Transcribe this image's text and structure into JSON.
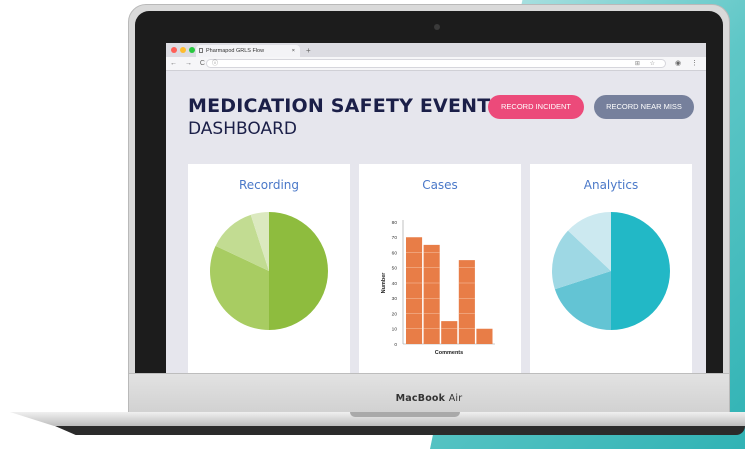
{
  "browser": {
    "tab_title": "Pharmapod GRLS Flow",
    "tab_close": "×",
    "new_tab": "+",
    "nav_buttons": "← → C",
    "url_icon": "ⓘ",
    "omnibox_right": "⊞ ☆",
    "ext_buttons": "◉ ⋮",
    "dot_colors": [
      "#ff5f57",
      "#febc2e",
      "#28c840"
    ]
  },
  "header": {
    "title_bold": "MEDICATION SAFETY EVENT",
    "title_sep": "|",
    "title_light": "DASHBOARD"
  },
  "actions": {
    "record_incident": "RECORD INCIDENT",
    "record_near_miss": "RECORD NEAR MISS"
  },
  "cards": {
    "recording": {
      "title": "Recording"
    },
    "cases": {
      "title": "Cases"
    },
    "analytics": {
      "title": "Analytics"
    }
  },
  "laptop": {
    "brand_bold": "MacBook",
    "brand_light": "Air"
  },
  "chart_data": [
    {
      "type": "pie",
      "labels": [
        "",
        "",
        "",
        ""
      ],
      "values": [
        50,
        32,
        13,
        5
      ],
      "colors": [
        "#8ebc3e",
        "#a8cc62",
        "#c2dc92",
        "#dbe9bf"
      ]
    },
    {
      "type": "bar",
      "categories": [
        "",
        "",
        "",
        "",
        ""
      ],
      "values": [
        70,
        65,
        15,
        55,
        10
      ],
      "xlabel": "Comments",
      "ylabel": "Number",
      "ylim": [
        0,
        80
      ],
      "yticks": [
        0,
        10,
        20,
        30,
        40,
        50,
        60,
        70,
        80
      ],
      "color": "#e87d47"
    },
    {
      "type": "pie",
      "labels": [
        "",
        "",
        "",
        ""
      ],
      "values": [
        50,
        20,
        17,
        13
      ],
      "colors": [
        "#22b8c6",
        "#63c4d4",
        "#9ed8e4",
        "#cce9f0"
      ]
    }
  ]
}
